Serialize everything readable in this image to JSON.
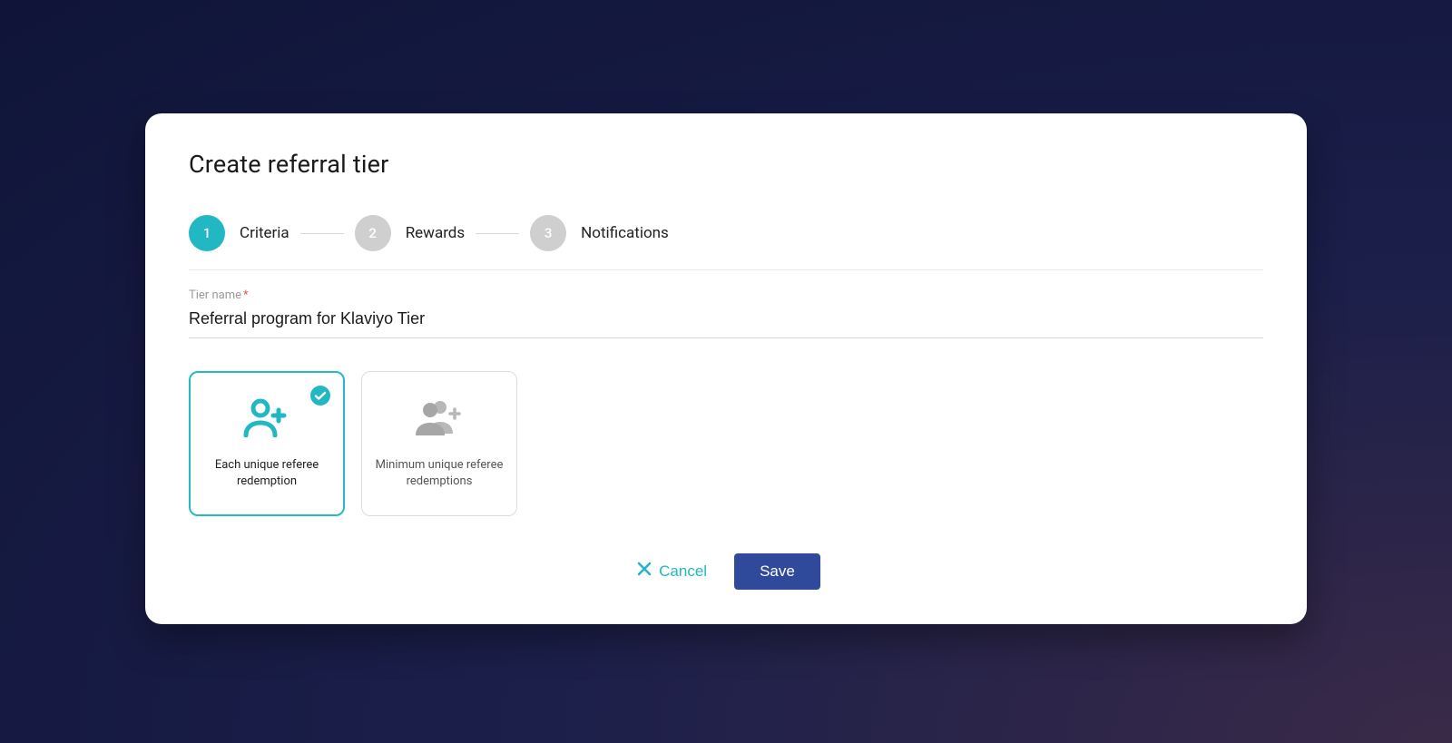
{
  "title": "Create referral tier",
  "stepper": {
    "steps": [
      {
        "num": "1",
        "label": "Criteria",
        "active": true
      },
      {
        "num": "2",
        "label": "Rewards",
        "active": false
      },
      {
        "num": "3",
        "label": "Notifications",
        "active": false
      }
    ]
  },
  "tier_name": {
    "label": "Tier name",
    "required_marker": "*",
    "value": "Referral program for Klaviyo Tier"
  },
  "options": [
    {
      "label": "Each unique referee redemption",
      "selected": true,
      "icon": "person-add-icon"
    },
    {
      "label": "Minimum unique referee redemptions",
      "selected": false,
      "icon": "people-add-icon"
    }
  ],
  "footer": {
    "cancel": "Cancel",
    "save": "Save"
  },
  "colors": {
    "accent": "#22b8c3",
    "primary_button": "#2f4a9a"
  }
}
